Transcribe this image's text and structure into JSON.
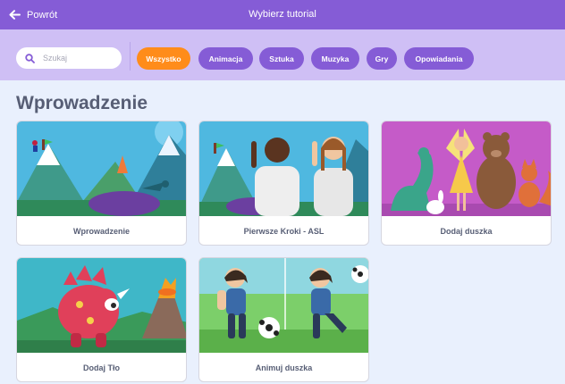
{
  "header": {
    "back_label": "Powrót",
    "title": "Wybierz tutorial"
  },
  "search": {
    "placeholder": "Szukaj",
    "value": ""
  },
  "filters": [
    "Wszystko",
    "Animacja",
    "Sztuka",
    "Muzyka",
    "Gry",
    "Opowiadania"
  ],
  "active_filter": "Wszystko",
  "section": {
    "heading": "Wprowadzenie"
  },
  "cards": [
    {
      "label": "Wprowadzenie"
    },
    {
      "label": "Pierwsze Kroki - ASL"
    },
    {
      "label": "Dodaj duszka"
    },
    {
      "label": "Dodaj Tło"
    },
    {
      "label": "Animuj duszka"
    }
  ],
  "colors": {
    "header": "#855cd6",
    "filter_bar": "#cfbff5",
    "active_chip": "#ff8c1a",
    "page": "#e9f0fd",
    "text": "#575e75"
  }
}
